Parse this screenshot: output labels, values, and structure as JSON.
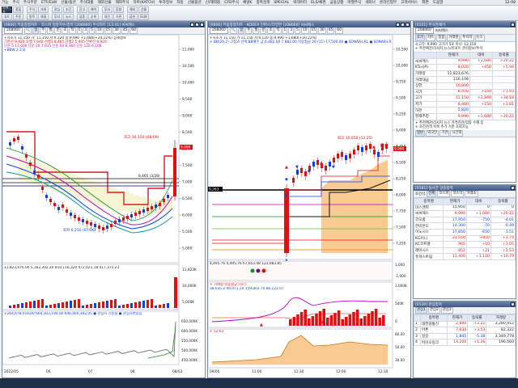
{
  "menu": [
    "기능",
    "주식",
    "주식주문",
    "ETF/ELW",
    "선물/옵션",
    "주식대출",
    "해외선물",
    "해외주식",
    "차트(KATCH)",
    "투자정보",
    "자동",
    "선물옵션",
    "신/해외옵",
    "CFD주식",
    "채널K",
    "종목검색",
    "SPECIAL",
    "빅데이터",
    "ELS/채권",
    "금융상품",
    "마켓주식",
    "세미나",
    "온라인업무",
    "고객서비스",
    "화면",
    "도움말"
  ],
  "menu_time": "12:08",
  "toolbar": {
    "groups": [
      [
        "현재가",
        "종합",
        "차트",
        "주문"
      ],
      [
        "주식",
        "거래",
        "종목",
        "체결"
      ],
      [
        "관심",
        "조건",
        "투자",
        "뉴스"
      ],
      [
        "잔고",
        "예약",
        "업종",
        "순위"
      ],
      [
        "투자",
        "동향",
        "외인",
        "기관"
      ],
      [
        "해외",
        "선물",
        "옵션",
        "ELW"
      ]
    ]
  },
  "left_chart": {
    "title": "[0600] 키움종합차트 - 코스피 업종지수/종목 [208060] 주식차트 [13:41] 씨씨에스",
    "code": "208060",
    "period_chips": [
      "일",
      "주",
      "월",
      "분",
      "초",
      "틱",
      "1",
      "3",
      "5",
      "10",
      "15",
      "30",
      "45",
      "60"
    ],
    "legend_line1": "+시초가 11,150 가: 11,150 저:9,120 종:9,990 +1,680(+20.22%) 상세정보",
    "legend_line2": "기준선 9,920 후행 7,640 선행1 8,465 선행2 5,945 전환선 9,920",
    "legend_line3": "단순 5 11,000 단순 20 7,935 단순 60 6,360 단순 120 6,108",
    "legend_line4": "+BBW 2 2.8",
    "annot_high": "최고 10,150 (08/09)",
    "annot_low": "최저 6,210 (07/06)",
    "annot_mid": "8,465 (3/28)",
    "price_labels": [
      "11,000",
      "10,500",
      "10,000",
      "9,500",
      "9,000",
      "8,500",
      "8,000",
      "7,500",
      "7,000",
      "6,500",
      "6,000",
      "5,500",
      "5,000"
    ],
    "current_price": "9,990",
    "vol_legend": "11,823,676.00 5,162,202.20 810,116,320 472,021,18 417,375.23",
    "vol_price_labels": [
      "11,823K",
      "10,000K",
      "5,000K"
    ],
    "vol_current": "11,823K",
    "obv_legend": "+264,678,016.00 664,303,194.00 646,460,392.05 ● 관심시 기준봉 ● 관심시변동등",
    "obv_labels": [
      "650,000K",
      "600,000K",
      "550,000K",
      "500,000K",
      "450,000K"
    ],
    "date_labels": [
      "2022/05",
      "06",
      "07",
      "08",
      "08/03"
    ]
  },
  "mid_chart": {
    "title": "[0600] 키움종합차트 - KODEX 인버스/다양한 [208060] 씨씨에스",
    "legend_line1": "+시초가 11,150 가:11,150 저:9,120 종:9,990 +1,680(+20.22%)",
    "legend_line2": "+ BB(20,2) 고점과 선택 BB매수 금,6,482.00 7,882.00 이동평균 20 (11) 17,500.00 ● SONAR-LRL ● SONAR-LRL 신호선",
    "annot_high": "최고 10,050 (12:25)",
    "annot_low": "",
    "price_labels": [
      "10,500",
      "10,000",
      "9,750",
      "9,500",
      "9,250",
      "9,000",
      "8,750",
      "8,500",
      "8,250",
      "8,000",
      "7,750",
      "7,500",
      "7,250"
    ],
    "current_price": "9,990",
    "mark_price": "9,263",
    "osc_legend": "4,495.76  4,495.76 67,653.48 123,083.85",
    "osc_labels": [
      "1,000",
      "-1,000"
    ],
    "vol_legend": "+ 거래량-이동평균크로스",
    "vol_legend2": "38,035.2 46,071.20 159,803.70 86,122.07",
    "vol_labels": [
      "1,000K",
      "500K",
      "0"
    ],
    "sub_legend": "+ 52.63",
    "sub_labels": [
      "80.00",
      "50.00",
      "30.00"
    ],
    "time_labels": [
      "09/00",
      "11:00",
      "11:30",
      "12:00",
      "12:30"
    ]
  },
  "quote": {
    "title": "[0101] 주식현재가",
    "code": "208060",
    "name": "씨씨에스",
    "tabs": [
      "호가",
      "차트",
      "종합",
      "거래원",
      "투자자",
      "뉴스"
    ],
    "sub_tabs": [
      "일반",
      "외국인",
      "기관",
      "시간외"
    ],
    "info_line": "소고가: 9,990 고가가 5로 이나: 12,150",
    "info_line2": "+ 추천매관/리서치,뉴스/리포트 관리정보/주석",
    "head": [
      "",
      "현재가",
      "대비",
      "등락률"
    ],
    "rows": [
      {
        "label": "씨씨에스",
        "price": "9,990",
        "diff": "+1,680",
        "rate": "+20.22",
        "cls": "red"
      },
      {
        "label": "KTcs(P)",
        "price": "8,020",
        "diff": "+450",
        "rate": "+5.94",
        "cls": "red"
      },
      {
        "label": "거래량",
        "price": "11,823,676",
        "diff": "",
        "rate": "",
        "cls": ""
      },
      {
        "label": "거래대금",
        "price": "116,108",
        "diff": "",
        "rate": "",
        "cls": ""
      },
      {
        "label": "상한",
        "price": "10,800",
        "diff": "",
        "rate": "",
        "cls": "red"
      },
      {
        "label": "시가",
        "price": "8,470",
        "diff": "+160",
        "rate": "+1.93",
        "cls": "red"
      },
      {
        "label": "고가",
        "price": "11,150",
        "diff": "+2,840",
        "rate": "+34.18",
        "cls": "red"
      },
      {
        "label": "저가",
        "price": "8,460",
        "diff": "+150",
        "rate": "+1.81",
        "cls": "red"
      },
      {
        "label": "하한",
        "price": "5,820",
        "diff": "",
        "rate": "",
        "cls": "blue"
      },
      {
        "label": "현재추정",
        "price": "9,990",
        "diff": "+1,680",
        "rate": "+20.22",
        "cls": "red"
      }
    ],
    "notes": [
      "+ 추천매관/리서치 뉴스 가격관관/업종 수혜 등",
      "+ 조건검색 목록 추가 기준 조회가능"
    ]
  },
  "ranking": {
    "title": "[0181] 실시간 상승종목",
    "search_label": "조건식",
    "tabs": [
      "전체",
      "코스피",
      "코스닥",
      "거래소"
    ],
    "head": [
      "종목명",
      "현재가",
      "대비",
      "등락률"
    ],
    "rows": [
      {
        "name": "미스앤피",
        "price": "15,950",
        "diff": "0",
        "rate": "0",
        "cls": ""
      },
      {
        "name": "씨씨에스",
        "price": "9,990",
        "diff": "+1,680",
        "rate": "+20.22",
        "cls": "red"
      },
      {
        "name": "코오롱",
        "price": "17,950",
        "diff": "-750",
        "rate": "-4.01",
        "cls": "blue"
      },
      {
        "name": "한미반도",
        "price": "14,300",
        "diff": "-70",
        "rate": "-0.49",
        "cls": "blue"
      },
      {
        "name": "이노시스",
        "price": "17,850",
        "diff": "-650",
        "rate": "-3.51",
        "cls": "blue"
      },
      {
        "name": "KG이니",
        "price": "23,550",
        "diff": "+850",
        "rate": "+3.74",
        "cls": "red"
      },
      {
        "name": "KC코트렐",
        "price": "965",
        "diff": "+10",
        "rate": "+1.05",
        "cls": "red"
      },
      {
        "name": "레이시스",
        "price": "852",
        "diff": "+21",
        "rate": "+2.53",
        "cls": "red"
      },
      {
        "name": "퓨쳐스트림",
        "price": "11,400",
        "diff": "+1,110",
        "rate": "+10.79",
        "cls": "red"
      }
    ]
  },
  "favorites": {
    "title": "[0130] 관심종목",
    "tabs": [
      "관심1",
      "관심2",
      "관심3"
    ],
    "head": [
      "",
      "종목명",
      "현재가",
      "등락률",
      "거래량"
    ],
    "rows": [
      {
        "no": "1",
        "name": "대한광통신",
        "price": "2,890",
        "rate": "+3.21",
        "vol": "3,280,912",
        "cls": "red"
      },
      {
        "no": "2",
        "name": "아톤",
        "price": "7,630",
        "diff": "+3.53",
        "rate": "+3.53",
        "vol": "82,322",
        "cls": "red"
      },
      {
        "no": "3",
        "name": "일승",
        "price": "1,845",
        "rate": "-5.38",
        "vol": "3,349,778",
        "cls": "blue"
      },
      {
        "no": "4",
        "name": "파이오링크",
        "price": "14,200",
        "rate": "+1.26",
        "vol": "196,560",
        "cls": "red"
      }
    ]
  },
  "colors": {
    "up": "#e01010",
    "down": "#1040e0",
    "title_bg": "#3f5885"
  }
}
